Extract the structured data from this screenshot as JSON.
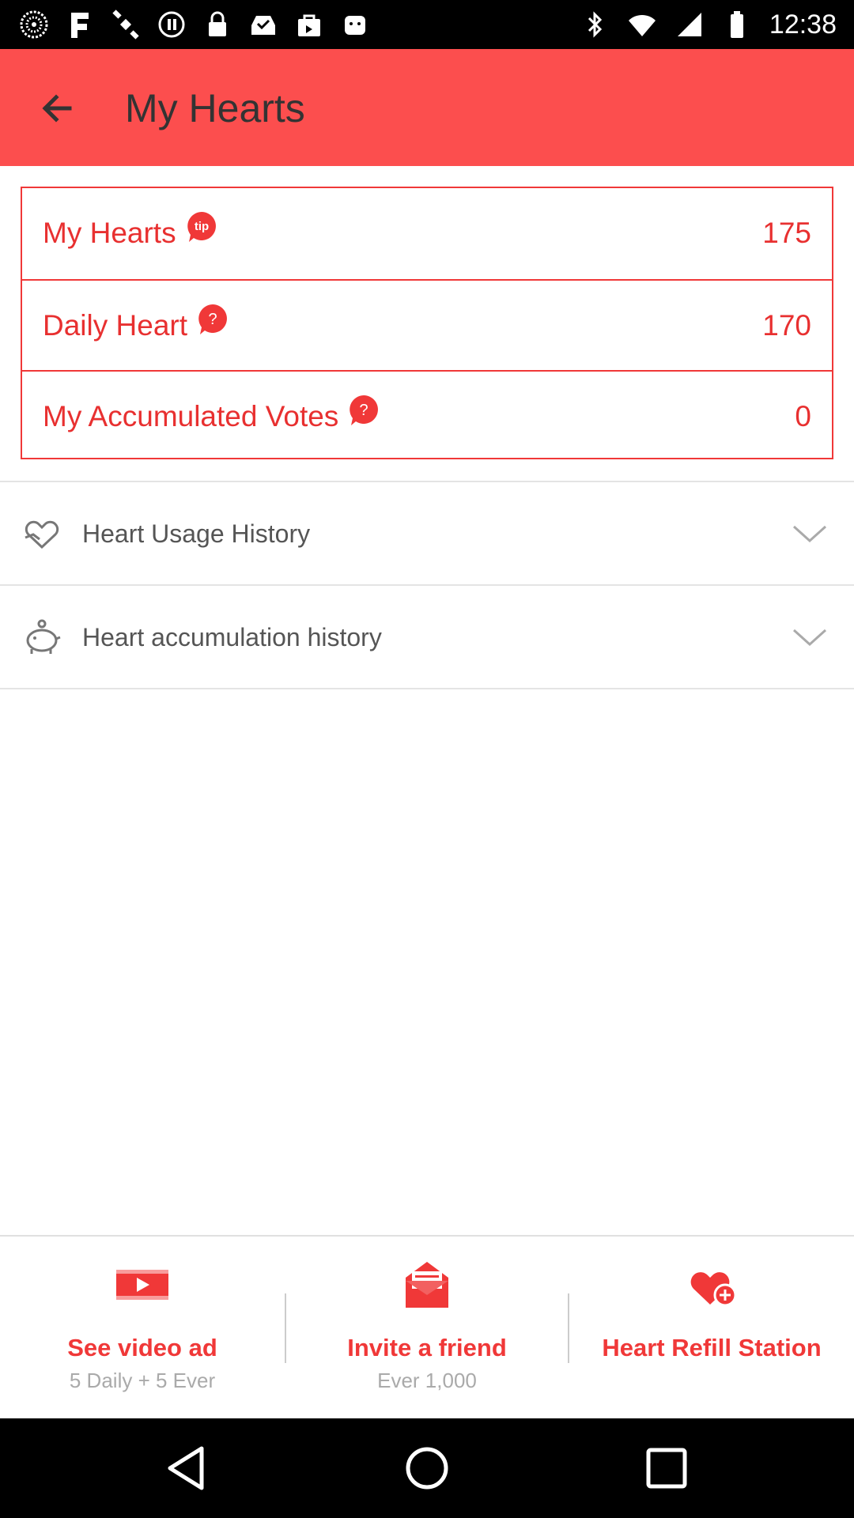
{
  "status_bar": {
    "time": "12:38",
    "left_icons": [
      "activity-icon",
      "fake-app-icon",
      "satellite-icon",
      "record-icon",
      "lock-icon",
      "inbox-check-icon",
      "shopping-bag-icon",
      "android-icon"
    ],
    "right_icons": [
      "bluetooth-icon",
      "wifi-icon",
      "signal-icon",
      "battery-icon"
    ]
  },
  "app_bar": {
    "back_icon": "arrow-back-icon",
    "title": "My Hearts",
    "color": "#fc4e4e"
  },
  "summary": {
    "rows": [
      {
        "label": "My Hearts",
        "badge": "tip",
        "value": "175"
      },
      {
        "label": "Daily Heart",
        "badge": "?",
        "value": "170"
      },
      {
        "label": "My Accumulated Votes",
        "badge": "?",
        "value": "0"
      }
    ]
  },
  "history": {
    "items": [
      {
        "label": "Heart Usage History",
        "icon": "heart-outline-icon"
      },
      {
        "label": "Heart accumulation history",
        "icon": "piggy-bank-icon"
      }
    ]
  },
  "bottom_actions": [
    {
      "label": "See video ad",
      "sub": "5 Daily + 5 Ever",
      "icon": "video-icon"
    },
    {
      "label": "Invite a friend",
      "sub": "Ever 1,000",
      "icon": "envelope-icon"
    },
    {
      "label": "Heart Refill Station",
      "sub": "",
      "icon": "heart-plus-icon"
    }
  ],
  "nav_bar": {
    "icons": [
      "back-triangle-icon",
      "home-circle-icon",
      "recents-square-icon"
    ]
  },
  "colors": {
    "accent": "#f03838",
    "appbar": "#fc4e4e"
  }
}
